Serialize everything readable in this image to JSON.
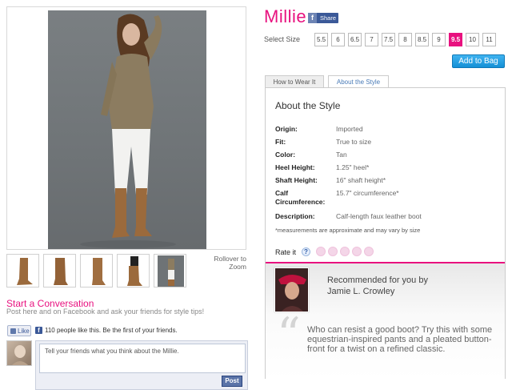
{
  "product": {
    "name": "Millie",
    "share_label": "Share",
    "share_f": "f"
  },
  "size_selector": {
    "label": "Select Size",
    "sizes": [
      "5.5",
      "6",
      "6.5",
      "7",
      "7.5",
      "8",
      "8.5",
      "9",
      "9.5",
      "10",
      "11"
    ],
    "selected": "9.5"
  },
  "add_to_bag": "Add to Bag",
  "tabs": [
    {
      "label": "How to Wear It",
      "active": false
    },
    {
      "label": "About the Style",
      "active": true
    }
  ],
  "about": {
    "heading": "About the Style",
    "specs": [
      {
        "label": "Origin:",
        "value": "Imported"
      },
      {
        "label": "Fit:",
        "value": "True to size"
      },
      {
        "label": "Color:",
        "value": "Tan"
      },
      {
        "label": "Heel Height:",
        "value": "1.25\" heel*"
      },
      {
        "label": "Shaft Height:",
        "value": "16\" shaft height*"
      },
      {
        "label": "Calf Circumference:",
        "value": "15.7\" circumference*"
      },
      {
        "label": "Description:",
        "value": "Calf-length faux leather boot"
      }
    ],
    "note": "*measurements are approximate and may vary by size",
    "rate_label": "Rate it",
    "rate_help": "?"
  },
  "recommendation": {
    "title_line1": "Recommended for you by",
    "title_line2": "Jamie L. Crowley",
    "quote_glyph": "“",
    "body": "Who can resist a good boot? Try this with some equestrian-inspired pants and a pleated button-front for a twist on a refined classic."
  },
  "gallery": {
    "rollover_line1": "Rollover to",
    "rollover_line2": "Zoom"
  },
  "conversation": {
    "title": "Start a Conversation",
    "subtitle": "Post here and on Facebook and ask your friends for style tips!",
    "like_label": "Like",
    "fb_glyph": "f",
    "like_text": "110 people like this. Be the first of your friends.",
    "comment_placeholder": "Tell your friends what you think about the Millie.",
    "post_label": "Post"
  },
  "colors": {
    "brand_pink": "#e8117f",
    "accent_blue": "#1490d6",
    "facebook_blue": "#3b5998"
  }
}
